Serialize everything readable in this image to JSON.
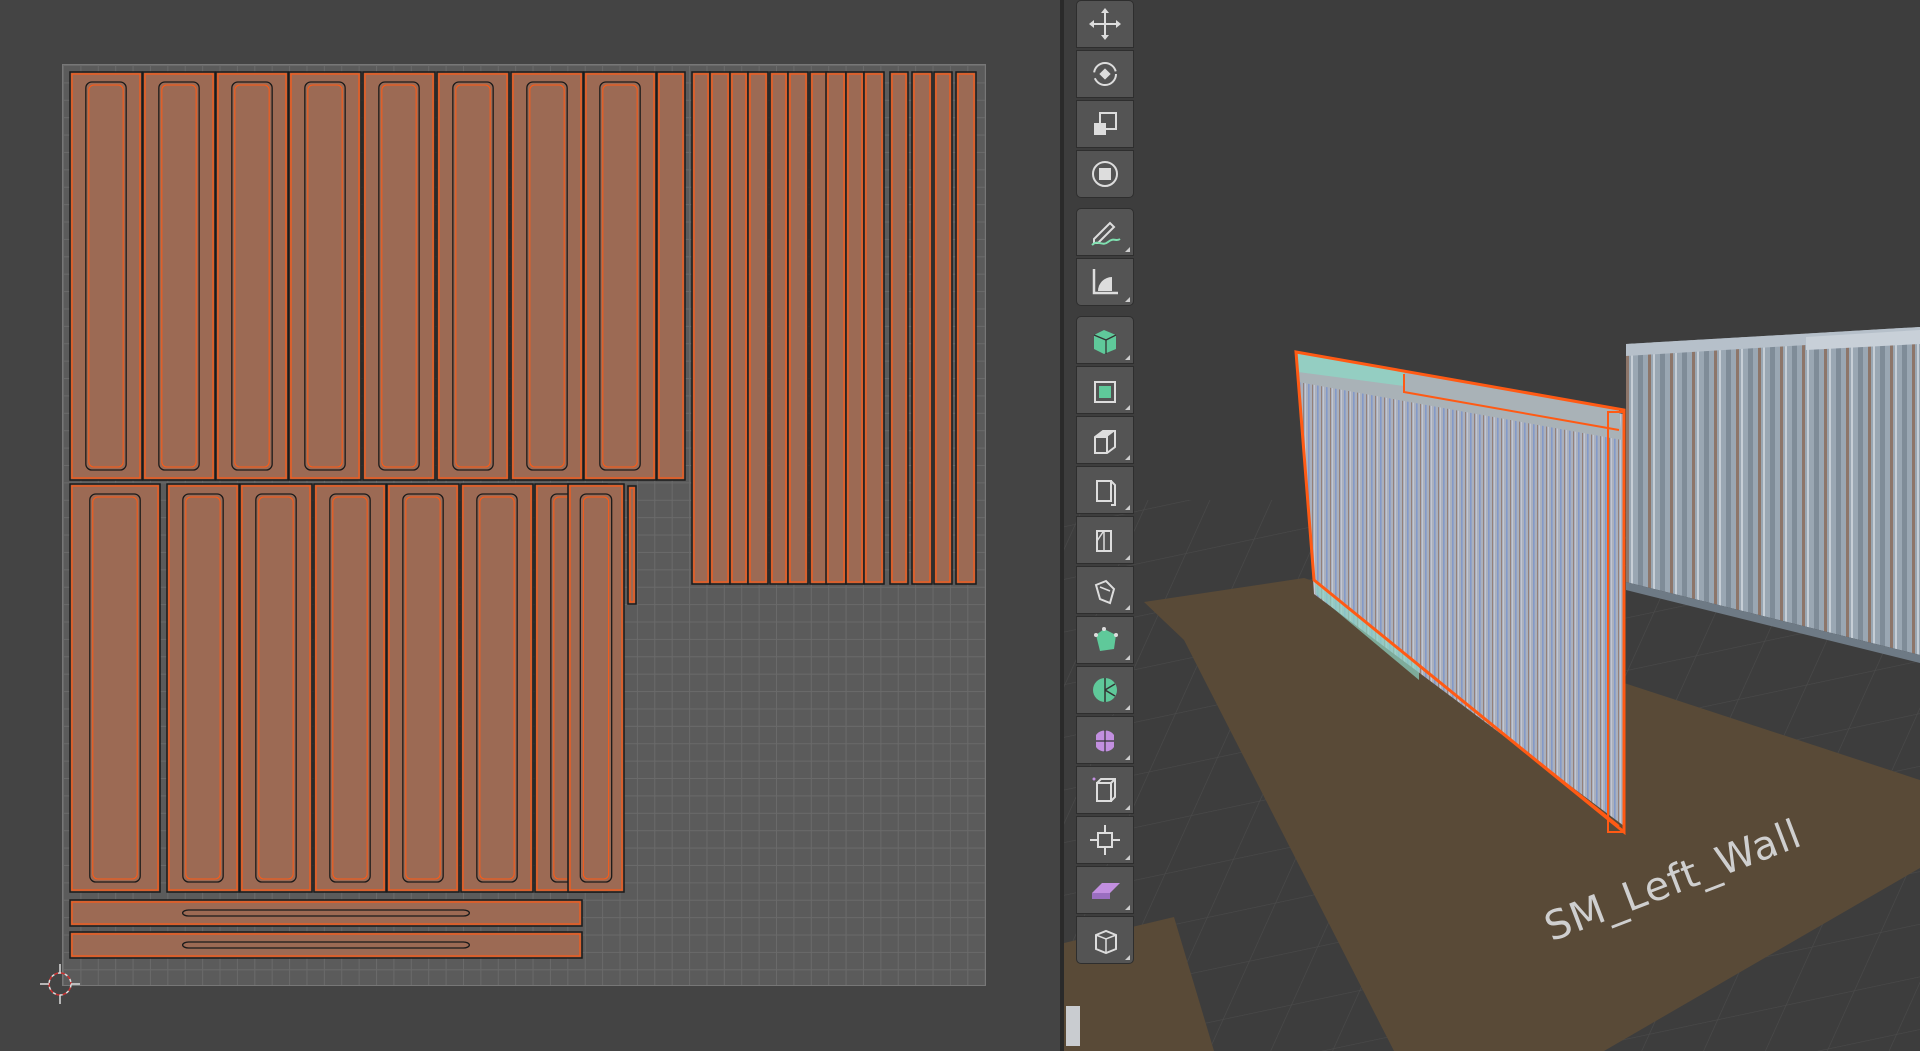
{
  "uv_editor": {
    "cursor_icon": "2d-cursor-icon"
  },
  "viewport": {
    "object_name": "SM_Left_Wall",
    "colors": {
      "selection_outline": "#ff5a14",
      "uv_island_fill": "#9c6a54",
      "ground_plane": "#5b4a35",
      "wall_texture": "#a8b4c0"
    }
  },
  "toolbar": {
    "tools": [
      {
        "icon": "move-icon",
        "group": "top"
      },
      {
        "icon": "rotate-icon",
        "group": "mid"
      },
      {
        "icon": "scale-icon",
        "group": "mid"
      },
      {
        "icon": "transform-icon",
        "group": "bot"
      },
      {
        "icon": "annotate-icon",
        "group": "top"
      },
      {
        "icon": "measure-icon",
        "group": "bot"
      },
      {
        "icon": "add-cube-icon",
        "group": "top"
      },
      {
        "icon": "extrude-region-icon",
        "group": "mid"
      },
      {
        "icon": "inset-faces-icon",
        "group": "mid"
      },
      {
        "icon": "bevel-icon",
        "group": "mid"
      },
      {
        "icon": "loop-cut-icon",
        "group": "mid"
      },
      {
        "icon": "knife-icon",
        "group": "mid"
      },
      {
        "icon": "poly-build-icon",
        "group": "mid"
      },
      {
        "icon": "spin-icon",
        "group": "mid"
      },
      {
        "icon": "smooth-vertices-icon",
        "group": "mid"
      },
      {
        "icon": "edge-slide-icon",
        "group": "mid"
      },
      {
        "icon": "shrink-fatten-icon",
        "group": "mid"
      },
      {
        "icon": "shear-icon",
        "group": "mid"
      },
      {
        "icon": "rip-region-icon",
        "group": "bot"
      }
    ]
  }
}
